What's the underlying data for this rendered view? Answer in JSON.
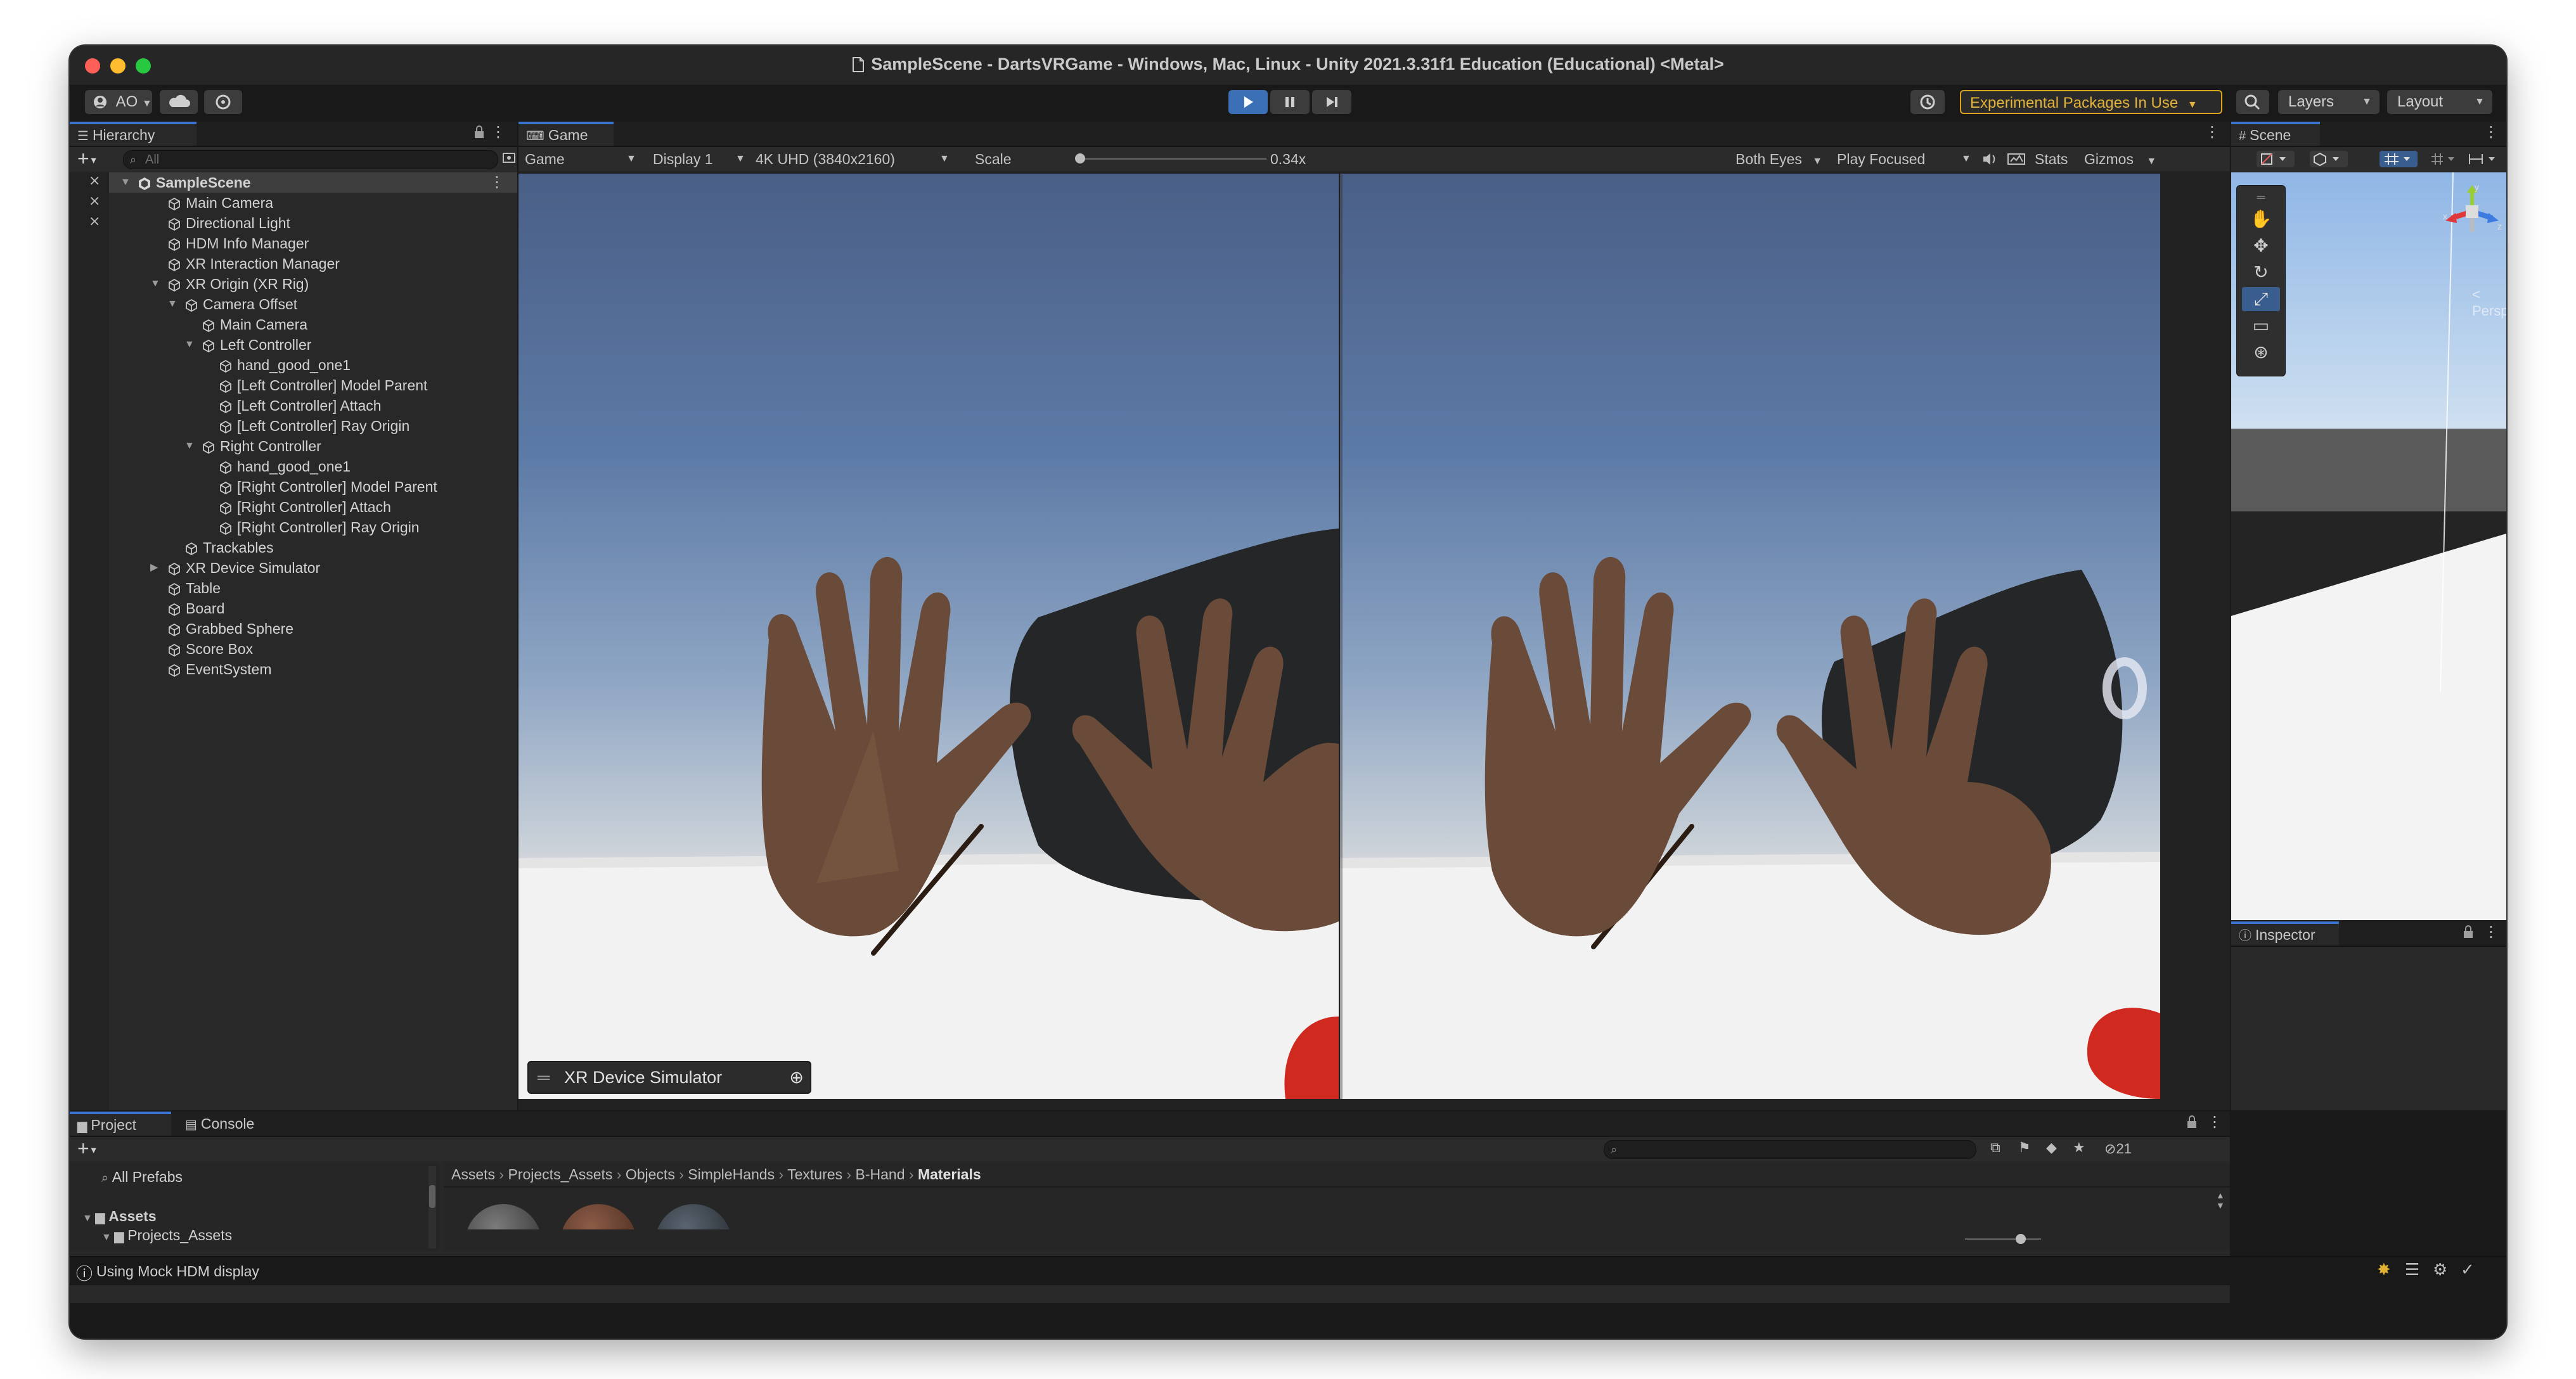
{
  "window": {
    "title": "SampleScene - DartsVRGame - Windows, Mac, Linux - Unity 2021.3.31f1 Education (Educational) <Metal>"
  },
  "toolbar": {
    "account_label": "AO",
    "experimental_label": "Experimental Packages In Use",
    "layers_label": "Layers",
    "layout_label": "Layout"
  },
  "hierarchy": {
    "tab_label": "Hierarchy",
    "search_placeholder": "All",
    "add_label": "+",
    "items": [
      {
        "label": "SampleScene",
        "depth": 0,
        "fold": "open",
        "scene": true
      },
      {
        "label": "Main Camera",
        "depth": 1
      },
      {
        "label": "Directional Light",
        "depth": 1
      },
      {
        "label": "HDM Info Manager",
        "depth": 1
      },
      {
        "label": "XR Interaction Manager",
        "depth": 1
      },
      {
        "label": "XR Origin (XR Rig)",
        "depth": 1,
        "fold": "open"
      },
      {
        "label": "Camera Offset",
        "depth": 2,
        "fold": "open"
      },
      {
        "label": "Main Camera",
        "depth": 3
      },
      {
        "label": "Left Controller",
        "depth": 3,
        "fold": "open"
      },
      {
        "label": "hand_good_one1",
        "depth": 4
      },
      {
        "label": "[Left Controller] Model Parent",
        "depth": 4
      },
      {
        "label": "[Left Controller] Attach",
        "depth": 4
      },
      {
        "label": "[Left Controller] Ray Origin",
        "depth": 4
      },
      {
        "label": "Right Controller",
        "depth": 3,
        "fold": "open"
      },
      {
        "label": "hand_good_one1",
        "depth": 4
      },
      {
        "label": "[Right Controller] Model Parent",
        "depth": 4
      },
      {
        "label": "[Right Controller] Attach",
        "depth": 4
      },
      {
        "label": "[Right Controller] Ray Origin",
        "depth": 4
      },
      {
        "label": "Trackables",
        "depth": 2
      },
      {
        "label": "XR Device Simulator",
        "depth": 1,
        "fold": "closed"
      },
      {
        "label": "Table",
        "depth": 1
      },
      {
        "label": "Board",
        "depth": 1
      },
      {
        "label": "Grabbed Sphere",
        "depth": 1
      },
      {
        "label": "Score Box",
        "depth": 1
      },
      {
        "label": "EventSystem",
        "depth": 1
      }
    ]
  },
  "game": {
    "tab_label": "Game",
    "mode_label": "Game",
    "display_label": "Display 1",
    "resolution_label": "4K UHD (3840x2160)",
    "scale_label": "Scale",
    "scale_value": "0.34x",
    "scale_fraction": 0.02,
    "eyes_label": "Both Eyes",
    "focus_label": "Play Focused",
    "stats_label": "Stats",
    "gizmos_label": "Gizmos",
    "simulator_label": "XR Device Simulator"
  },
  "scene": {
    "tab_label": "Scene",
    "persp_label": "< Persp",
    "axis_x": "x",
    "axis_y": "y",
    "axis_z": "z"
  },
  "inspector": {
    "tab_label": "Inspector"
  },
  "project": {
    "project_tab": "Project",
    "console_tab": "Console",
    "tree": [
      {
        "label": "All Prefabs",
        "depth": 1
      },
      {
        "label": "Assets",
        "depth": 0,
        "fold": "open"
      },
      {
        "label": "Projects_Assets",
        "depth": 1,
        "fold": "open"
      }
    ],
    "breadcrumb": [
      "Assets",
      "Projects_Assets",
      "Objects",
      "SimpleHands",
      "Textures",
      "B-Hand",
      "Materials"
    ],
    "hidden_count": "21"
  },
  "status": {
    "message": "Using Mock HDM display"
  },
  "colors": {
    "accent": "#3a73d0",
    "experimental": "#d9a21b",
    "play_active": "#3b6fb6"
  }
}
